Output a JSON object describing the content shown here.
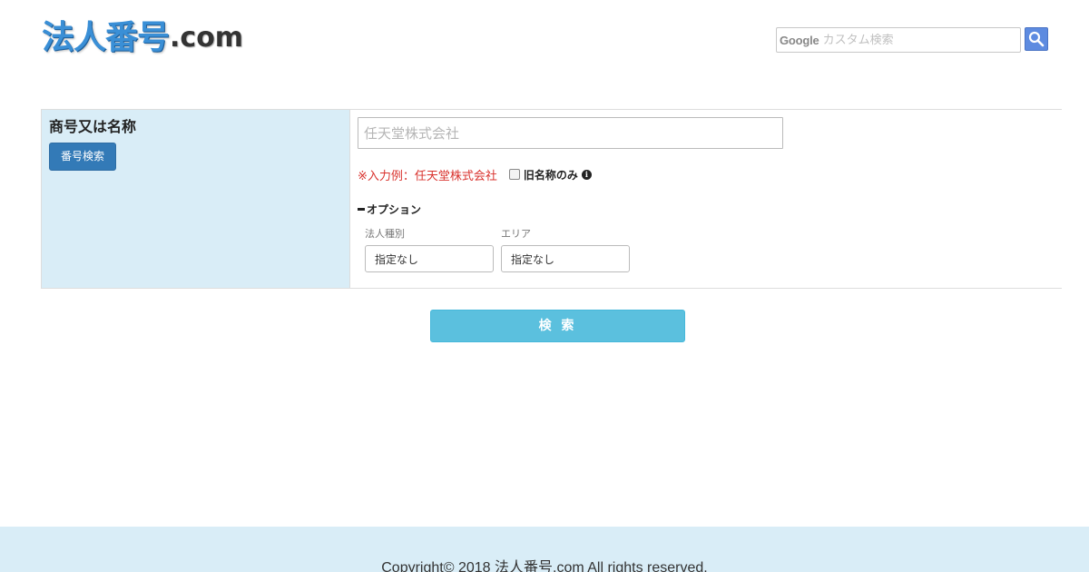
{
  "header": {
    "logo_jp": "法人番号",
    "logo_suffix": ".com",
    "search": {
      "brand": "Google",
      "placeholder": "カスタム検索",
      "button_icon": "search-icon"
    }
  },
  "form": {
    "field_title": "商号又は名称",
    "number_search_button": "番号検索",
    "name_input_placeholder": "任天堂株式会社",
    "hint": "※入力例：任天堂株式会社",
    "old_name_checkbox_label": "旧名称のみ",
    "old_name_checkbox_checked": false,
    "info_icon": "info-icon",
    "options_toggle_label": "オプション",
    "options": [
      {
        "caption": "法人種別",
        "selected": "指定なし"
      },
      {
        "caption": "エリア",
        "selected": "指定なし"
      }
    ],
    "submit_label": "検 索"
  },
  "footer": {
    "copyright": "Copyright© 2018 法人番号.com All rights reserved."
  },
  "colors": {
    "logo_blue": "#3a8fd6",
    "label_cell_bg": "#d9edf7",
    "primary_button": "#337ab7",
    "submit_button": "#5bc0de",
    "hint_red": "#d9322d",
    "google_search_button": "#5d8be0"
  }
}
